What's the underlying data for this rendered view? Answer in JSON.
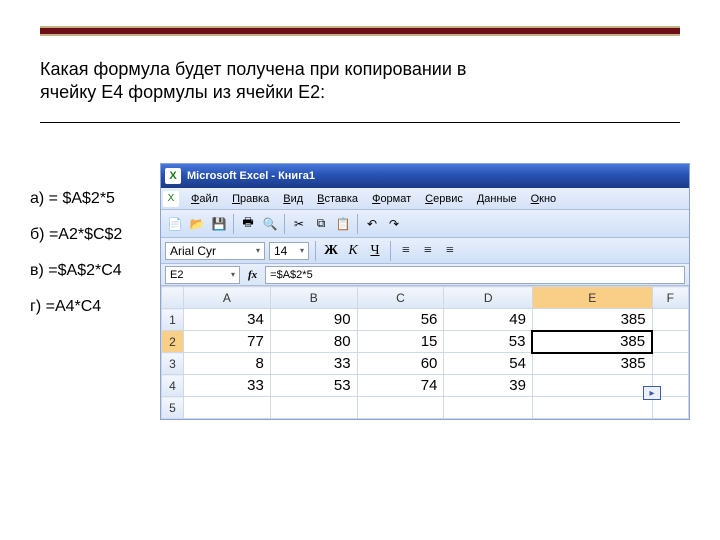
{
  "question": {
    "line1": "Какая формула будет получена при копировании в",
    "line2": "ячейку E4 формулы из ячейки E2:"
  },
  "answers": {
    "a": "а) = $A$2*5",
    "b": "б) =A2*$C$2",
    "c": "в) =$A$2*C4",
    "d": "г) =A4*C4"
  },
  "titlebar": "Microsoft Excel - Книга1",
  "menus": {
    "file": "Файл",
    "edit": "Правка",
    "view": "Вид",
    "insert": "Вставка",
    "format": "Формат",
    "tools": "Сервис",
    "data": "Данные",
    "window": "Окно"
  },
  "font": {
    "name": "Arial Cyr",
    "size": "14"
  },
  "fmt": {
    "bold": "Ж",
    "italic": "К",
    "underline": "Ч"
  },
  "namebox": "E2",
  "fx_label": "fx",
  "formula": "=$A$2*5",
  "cols": {
    "A": "A",
    "B": "B",
    "C": "C",
    "D": "D",
    "E": "E",
    "F": "F"
  },
  "rows": {
    "r1": {
      "h": "1",
      "A": "34",
      "B": "90",
      "C": "56",
      "D": "49",
      "E": "385",
      "F": ""
    },
    "r2": {
      "h": "2",
      "A": "77",
      "B": "80",
      "C": "15",
      "D": "53",
      "E": "385",
      "F": ""
    },
    "r3": {
      "h": "3",
      "A": "8",
      "B": "33",
      "C": "60",
      "D": "54",
      "E": "385",
      "F": ""
    },
    "r4": {
      "h": "4",
      "A": "33",
      "B": "53",
      "C": "74",
      "D": "39",
      "E": "",
      "F": ""
    },
    "r5": {
      "h": "5",
      "A": "",
      "B": "",
      "C": "",
      "D": "",
      "E": "",
      "F": ""
    }
  },
  "autofill": "▸"
}
